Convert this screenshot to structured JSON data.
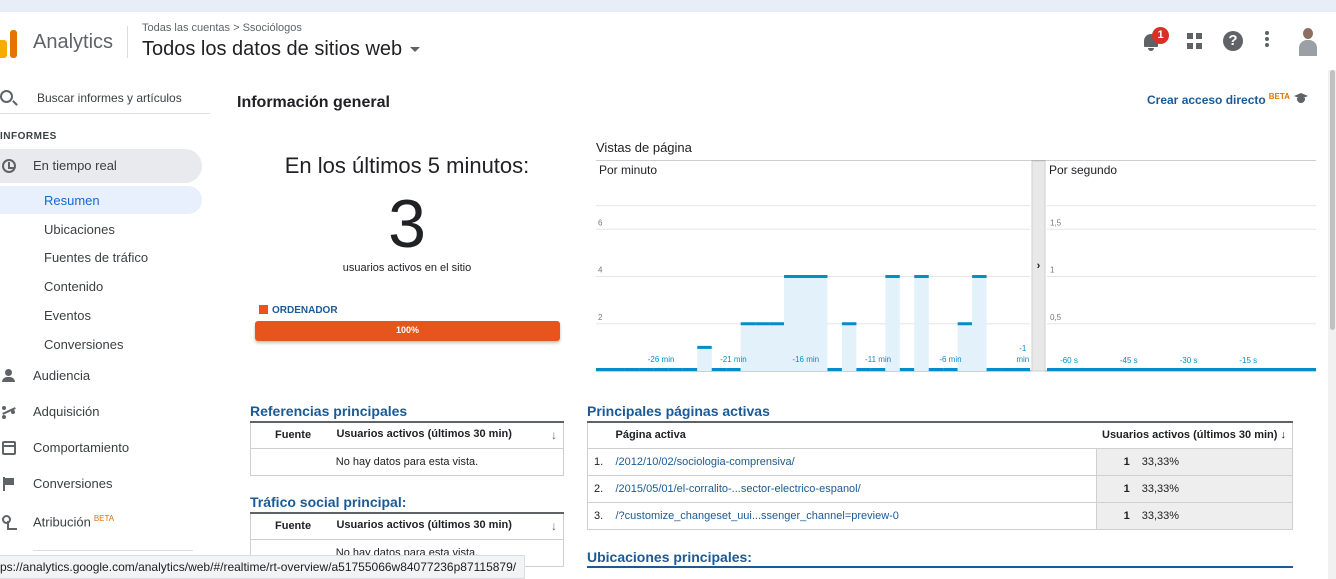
{
  "header": {
    "app_name": "Analytics",
    "breadcrumb": "Todas las cuentas > Ssociólogos",
    "property": "Todos los datos de sitios web",
    "notification_count": "1",
    "help_glyph": "?"
  },
  "sidebar": {
    "search_label": "Buscar informes y artículos",
    "section": "INFORMES",
    "realtime": "En tiempo real",
    "realtime_sub": [
      "Resumen",
      "Ubicaciones",
      "Fuentes de tráfico",
      "Contenido",
      "Eventos",
      "Conversiones"
    ],
    "audience": "Audiencia",
    "acquisition": "Adquisición",
    "behavior": "Comportamiento",
    "conversions": "Conversiones",
    "attribution": "Atribución",
    "attribution_badge": "BETA"
  },
  "status_url": "ps://analytics.google.com/analytics/web/#/realtime/rt-overview/a51755066w84077236p87115879/",
  "main": {
    "title": "Información general",
    "shortcut": "Crear acceso directo",
    "shortcut_badge": "BETA",
    "realtime_heading": "En los últimos 5 minutos:",
    "active_users": "3",
    "active_label": "usuarios activos en el sitio",
    "device_label": "ORDENADOR",
    "device_pct_label": "100%",
    "device_fraction": 1.0
  },
  "chart_data": {
    "type": "bar",
    "title": "Vistas de página",
    "panels": [
      {
        "name": "Por minuto",
        "x": [
          -30,
          -29,
          -28,
          -27,
          -26,
          -25,
          -24,
          -23,
          -22,
          -21,
          -20,
          -19,
          -18,
          -17,
          -16,
          -15,
          -14,
          -13,
          -12,
          -11,
          -10,
          -9,
          -8,
          -7,
          -6,
          -5,
          -4,
          -3,
          -2,
          -1
        ],
        "values": [
          0,
          0,
          0,
          0,
          0,
          0,
          0,
          1,
          0,
          0,
          2,
          2,
          2,
          4,
          4,
          4,
          0,
          2,
          0,
          0,
          4,
          0,
          4,
          0,
          0,
          2,
          4,
          0,
          0,
          0
        ],
        "ylim": [
          0,
          8
        ],
        "y_ticks": [
          "2",
          "4",
          "6"
        ],
        "x_ticks": [
          "-26 min",
          "-21 min",
          "-16 min",
          "-11 min",
          "-6 min",
          "-1 min"
        ]
      },
      {
        "name": "Por segundo",
        "ylim": [
          0,
          2
        ],
        "y_ticks": [
          "0,5",
          "1",
          "1,5"
        ],
        "x_ticks": [
          "-60 s",
          "-45 s",
          "-30 s",
          "-15 s"
        ],
        "values": []
      }
    ]
  },
  "referrals": {
    "title": "Referencias principales",
    "col_source": "Fuente",
    "col_users": "Usuarios activos (últimos 30 min)",
    "empty": "No hay datos para esta vista."
  },
  "social": {
    "title": "Tráfico social principal:",
    "col_source": "Fuente",
    "col_users": "Usuarios activos (últimos 30 min)",
    "empty": "No hay datos para esta vista."
  },
  "pages": {
    "title": "Principales páginas activas",
    "col_page": "Página activa",
    "col_users": "Usuarios activos (últimos 30 min)",
    "rows": [
      {
        "rank": "1.",
        "page": "/2012/10/02/sociologia-comprensiva/",
        "users": "1",
        "pct": "33,33%"
      },
      {
        "rank": "2.",
        "page": "/2015/05/01/el-corralito-...sector-electrico-espanol/",
        "users": "1",
        "pct": "33,33%"
      },
      {
        "rank": "3.",
        "page": "/?customize_changeset_uui...ssenger_channel=preview-0",
        "users": "1",
        "pct": "33,33%"
      }
    ]
  },
  "locations": {
    "title": "Ubicaciones principales:"
  }
}
